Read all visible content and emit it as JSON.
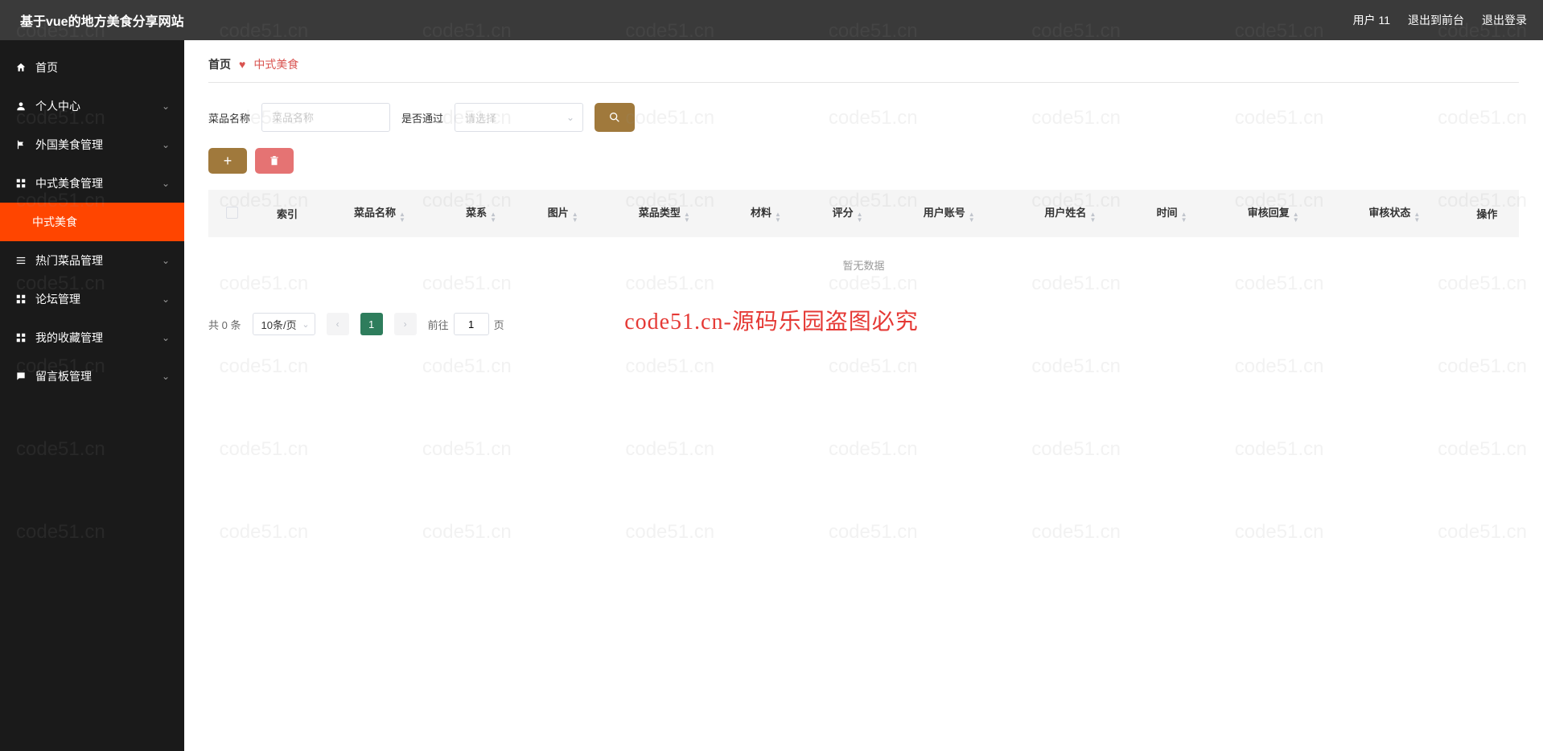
{
  "header": {
    "title": "基于vue的地方美食分享网站",
    "username": "用户 11",
    "back_to_front": "退出到前台",
    "logout": "退出登录"
  },
  "sidebar": {
    "items": [
      {
        "label": "首页",
        "icon": "home"
      },
      {
        "label": "个人中心",
        "icon": "user",
        "expandable": true
      },
      {
        "label": "外国美食管理",
        "icon": "flag",
        "expandable": true
      },
      {
        "label": "中式美食管理",
        "icon": "grid",
        "expandable": true,
        "expanded": true
      },
      {
        "label": "热门菜品管理",
        "icon": "list",
        "expandable": true
      },
      {
        "label": "论坛管理",
        "icon": "grid",
        "expandable": true
      },
      {
        "label": "我的收藏管理",
        "icon": "grid",
        "expandable": true
      },
      {
        "label": "留言板管理",
        "icon": "comment",
        "expandable": true
      }
    ],
    "active_sub": "中式美食"
  },
  "breadcrumb": {
    "home": "首页",
    "current": "中式美食"
  },
  "filters": {
    "name_label": "菜品名称",
    "name_placeholder": "菜品名称",
    "pass_label": "是否通过",
    "pass_placeholder": "请选择"
  },
  "table": {
    "columns": [
      "索引",
      "菜品名称",
      "菜系",
      "图片",
      "菜品类型",
      "材料",
      "评分",
      "用户账号",
      "用户姓名",
      "时间",
      "审核回复",
      "审核状态",
      "操作"
    ],
    "empty_text": "暂无数据"
  },
  "pagination": {
    "total_prefix": "共",
    "total_count": "0",
    "total_suffix": "条",
    "page_size": "10条/页",
    "current": "1",
    "jump_prefix": "前往",
    "jump_value": "1",
    "jump_suffix": "页"
  },
  "watermark": {
    "text": "code51.cn",
    "banner": "code51.cn-源码乐园盗图必究"
  }
}
